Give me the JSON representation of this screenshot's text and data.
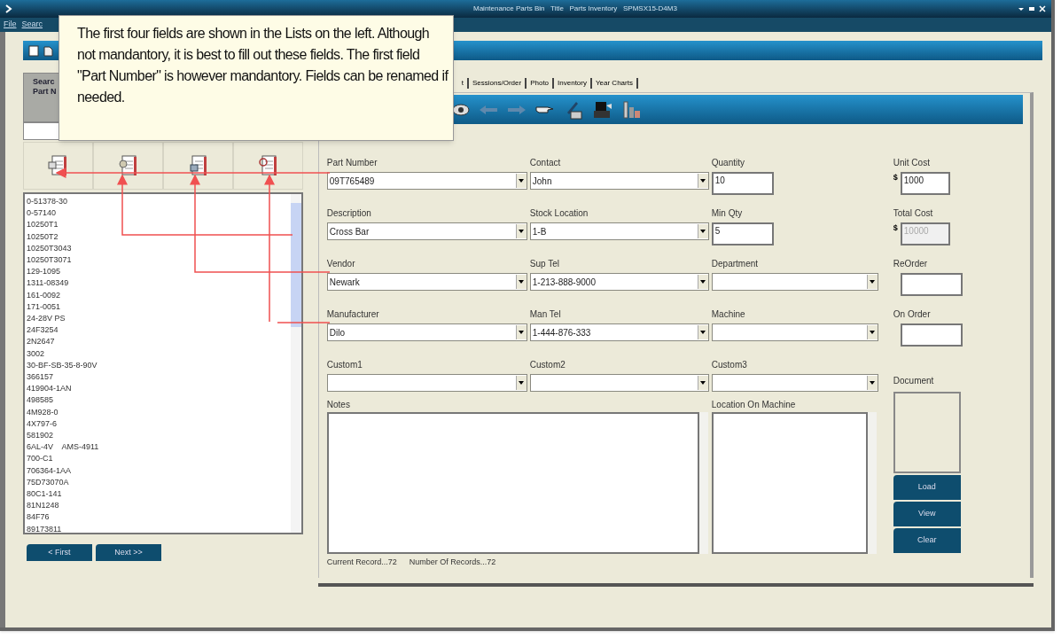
{
  "window": {
    "title": "Maintenance Parts Bin   Title   Parts Inventory   SPMSX15-D4M3"
  },
  "menu": [
    "File",
    "Searc"
  ],
  "tooltip": {
    "text": "The first four fields are shown in the Lists on the left. Although not mandantory, it is best to fill out these fields. The first field \"Part Number\" is however mandantory. Fields can be renamed if needed."
  },
  "search_panel": {
    "header_lines": [
      "Searc",
      "Part N"
    ],
    "list_items": [
      "0-51378-30",
      "0-57140",
      "10250T1",
      "10250T2",
      "10250T3043",
      "10250T3071",
      "129-1095",
      "1311-08349",
      "161-0092",
      "171-0051",
      "24-28V PS",
      "24F3254",
      "2N2647",
      "3002",
      "30-BF-SB-35-8-90V",
      "366157",
      "419904-1AN",
      "498585",
      "4M928-0",
      "4X797-6",
      "581902",
      "6AL-4V    AMS-4911",
      "700-C1",
      "706364-1AA",
      "75D73070A",
      "80C1-141",
      "81N1248",
      "84F76",
      "89173811"
    ],
    "nav_buttons": [
      "< First",
      "Next >>"
    ]
  },
  "tabs": [
    "t",
    "Sessions/Order",
    "Photo",
    "Inventory",
    "Year Charts"
  ],
  "form_rows": [
    [
      {
        "kind": "combo",
        "label": "Part Number",
        "value": "09T765489"
      },
      {
        "kind": "combo",
        "label": "Contact",
        "value": "John"
      },
      {
        "kind": "text",
        "label": "Quantity",
        "value": "10",
        "disabled": false
      },
      {
        "kind": "currency",
        "label": "Unit Cost",
        "prefix": "$",
        "value": "1000",
        "disabled": false
      }
    ],
    [
      {
        "kind": "combo",
        "label": "Description",
        "value": "Cross Bar"
      },
      {
        "kind": "combo",
        "label": "Stock Location",
        "value": "1-B"
      },
      {
        "kind": "text",
        "label": "Min Qty",
        "value": "5",
        "disabled": false
      },
      {
        "kind": "currency",
        "label": "Total Cost",
        "prefix": "$",
        "value": "10000",
        "disabled": true
      }
    ],
    [
      {
        "kind": "combo",
        "label": "Vendor",
        "value": "Newark"
      },
      {
        "kind": "combo",
        "label": "Sup Tel",
        "value": "1-213-888-9000"
      },
      {
        "kind": "combo",
        "label": "Department"
      },
      {
        "kind": "text",
        "label": "ReOrder",
        "disabled": false
      }
    ],
    [
      {
        "kind": "combo",
        "label": "Manufacturer",
        "value": "Dilo"
      },
      {
        "kind": "combo",
        "label": "Man Tel",
        "value": "1-444-876-333"
      },
      {
        "kind": "combo",
        "label": "Machine"
      },
      {
        "kind": "text",
        "label": "On Order",
        "disabled": false
      }
    ],
    [
      {
        "kind": "combo",
        "label": "Custom1"
      },
      {
        "kind": "combo",
        "label": "Custom2"
      },
      {
        "kind": "combo",
        "label": "Custom3"
      },
      {
        "kind": "label",
        "label": "Document"
      }
    ]
  ],
  "notes": {
    "label": "Notes"
  },
  "location": {
    "label": "Location On Machine"
  },
  "document_buttons": [
    "Load",
    "View",
    "Clear"
  ],
  "status": [
    "Current Record...72",
    "Number Of Records...72"
  ]
}
